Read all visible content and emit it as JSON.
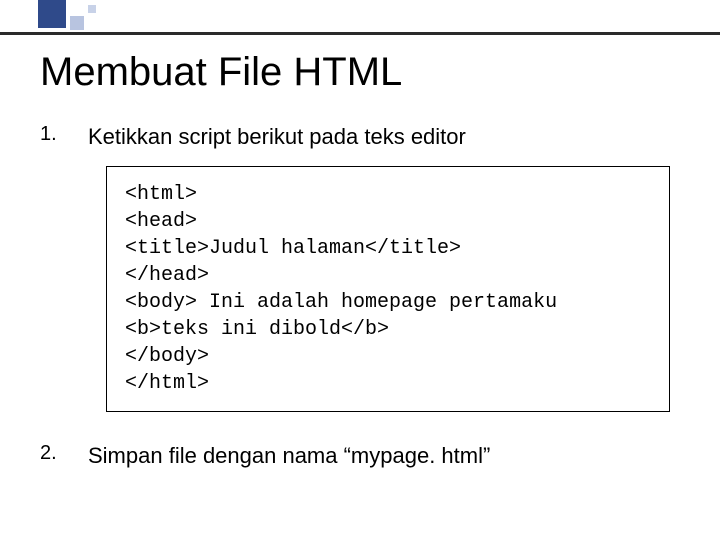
{
  "deco": {
    "name": "corner-decoration"
  },
  "title": "Membuat File HTML",
  "items": [
    {
      "num": "1.",
      "text": "Ketikkan script berikut pada teks editor"
    },
    {
      "num": "2.",
      "text": "Simpan file dengan nama “mypage. html”"
    }
  ],
  "code": "<html>\n<head>\n<title>Judul halaman</title>\n</head>\n<body> Ini adalah homepage pertamaku\n<b>teks ini dibold</b>\n</body>\n</html>"
}
